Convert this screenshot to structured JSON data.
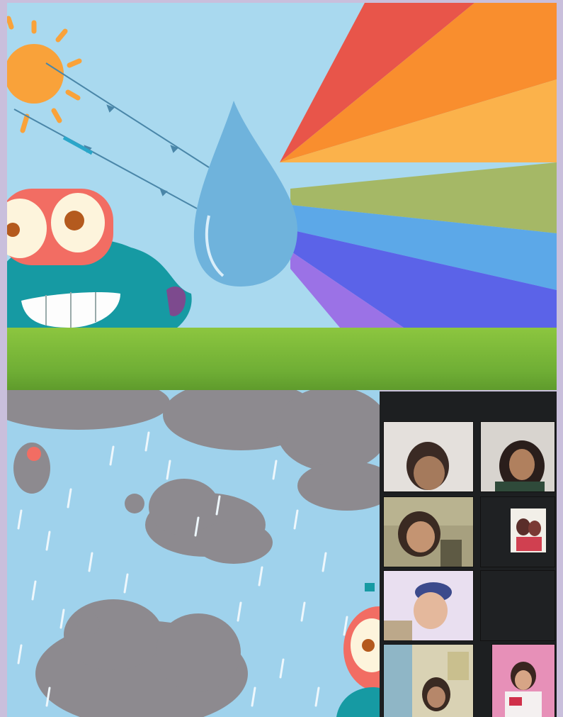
{
  "colors": {
    "sky_top": "#a9d9ef",
    "sky_bottom": "#9fd2ec",
    "grass": "#7cb83a",
    "rainbow": [
      "#e8554a",
      "#f98e2e",
      "#fbb24b",
      "#a5b866",
      "#5ca8e8",
      "#5b63e8",
      "#9b72e6"
    ],
    "drop": "#6fb3dc",
    "cloud": "#8d8a8f",
    "monster_body": "#169aa3",
    "monster_eye": "#f26d63",
    "sun": "#f9a23a"
  },
  "illustration": {
    "top_scene": "sun-rays-drop-rainbow",
    "bottom_scene": "rain-clouds"
  },
  "meeting": {
    "participants": [
      {
        "name": "",
        "video": true
      },
      {
        "name": "",
        "video": true
      },
      {
        "name": "",
        "video": true
      },
      {
        "name": "",
        "video": true
      },
      {
        "name": "",
        "video": true
      },
      {
        "name": "",
        "video": false
      },
      {
        "name": "",
        "video": true
      },
      {
        "name": "",
        "video": true
      }
    ]
  }
}
